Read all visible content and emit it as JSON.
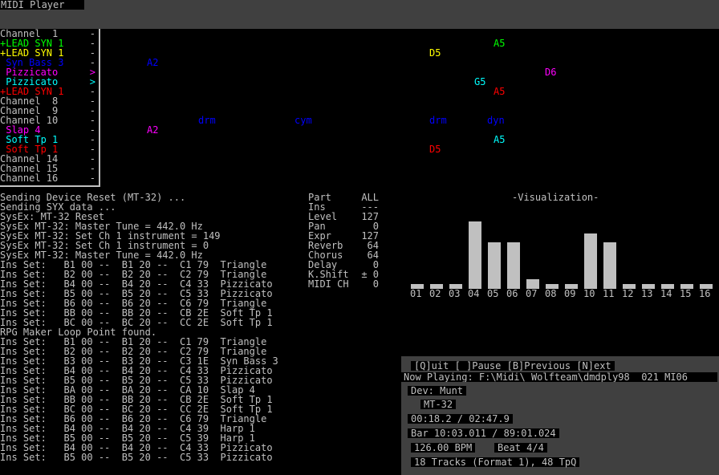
{
  "window": {
    "title": "MIDI Player"
  },
  "colors": {
    "background": "#000000",
    "text": "#c0c0c0",
    "panel": "#404040"
  },
  "channels": [
    {
      "label": "Channel  1",
      "color": "#c0c0c0",
      "marker": "-"
    },
    {
      "label": "+LEAD SYN 1",
      "color": "#00ff00",
      "marker": "-"
    },
    {
      "label": "+LEAD SYN 1",
      "color": "#ffff00",
      "marker": "-"
    },
    {
      "label": " Syn Bass 3",
      "color": "#0000ff",
      "marker": "-"
    },
    {
      "label": " Pizzicato",
      "color": "#ff00ff",
      "marker": ">"
    },
    {
      "label": " Pizzicato",
      "color": "#00ffff",
      "marker": ">"
    },
    {
      "label": "+LEAD SYN 1",
      "color": "#ff0000",
      "marker": "-"
    },
    {
      "label": "Channel  8",
      "color": "#c0c0c0",
      "marker": "-"
    },
    {
      "label": "Channel  9",
      "color": "#c0c0c0",
      "marker": "-"
    },
    {
      "label": "Channel 10",
      "color": "#c0c0c0",
      "marker": "-"
    },
    {
      "label": " Slap 4",
      "color": "#ff00ff",
      "marker": "-"
    },
    {
      "label": " Soft Tp 1",
      "color": "#00ffff",
      "marker": "-"
    },
    {
      "label": " Soft Tp 1",
      "color": "#ff0000",
      "marker": "-"
    },
    {
      "label": "Channel 14",
      "color": "#c0c0c0",
      "marker": "-"
    },
    {
      "label": "Channel 15",
      "color": "#c0c0c0",
      "marker": "-"
    },
    {
      "label": "Channel 16",
      "color": "#c0c0c0",
      "marker": "-"
    }
  ],
  "notes": [
    {
      "text": "A5",
      "row": 1,
      "col": 615,
      "color": "#00ff00"
    },
    {
      "text": "D5",
      "row": 2,
      "col": 535,
      "color": "#ffff00"
    },
    {
      "text": "A2",
      "row": 3,
      "col": 183,
      "color": "#0000ff"
    },
    {
      "text": "D6",
      "row": 4,
      "col": 679,
      "color": "#ff00ff"
    },
    {
      "text": "G5",
      "row": 5,
      "col": 591,
      "color": "#00ffff"
    },
    {
      "text": "A5",
      "row": 6,
      "col": 615,
      "color": "#ff0000"
    },
    {
      "text": "drm",
      "row": 9,
      "col": 247,
      "color": "#0000ff"
    },
    {
      "text": "cym",
      "row": 9,
      "col": 367,
      "color": "#0000ff"
    },
    {
      "text": "drm",
      "row": 9,
      "col": 535,
      "color": "#0000ff"
    },
    {
      "text": "dyn",
      "row": 9,
      "col": 607,
      "color": "#0000ff"
    },
    {
      "text": "A2",
      "row": 10,
      "col": 183,
      "color": "#ff00ff"
    },
    {
      "text": "A5",
      "row": 11,
      "col": 615,
      "color": "#00ffff"
    },
    {
      "text": "D5",
      "row": 12,
      "col": 535,
      "color": "#ff0000"
    }
  ],
  "log": [
    "Sending Device Reset (MT-32) ...",
    "Sending SYX data ...",
    "SysEx: MT-32 Reset",
    "SysEx MT-32: Master Tune = 442.0 Hz",
    "SysEx MT-32: Set Ch 1 instrument = 149",
    "SysEx MT-32: Set Ch 1 instrument = 0",
    "SysEx MT-32: Master Tune = 442.0 Hz",
    "Ins Set:   B1 00 --  B1 20 --  C1 79  Triangle",
    "Ins Set:   B2 00 --  B2 20 --  C2 79  Triangle",
    "Ins Set:   B4 00 --  B4 20 --  C4 33  Pizzicato",
    "Ins Set:   B5 00 --  B5 20 --  C5 33  Pizzicato",
    "Ins Set:   B6 00 --  B6 20 --  C6 79  Triangle",
    "Ins Set:   BB 00 --  BB 20 --  CB 2E  Soft Tp 1",
    "Ins Set:   BC 00 --  BC 20 --  CC 2E  Soft Tp 1",
    "RPG Maker Loop Point found.",
    "Ins Set:   B1 00 --  B1 20 --  C1 79  Triangle",
    "Ins Set:   B2 00 --  B2 20 --  C2 79  Triangle",
    "Ins Set:   B3 00 --  B3 20 --  C3 1E  Syn Bass 3",
    "Ins Set:   B4 00 --  B4 20 --  C4 33  Pizzicato",
    "Ins Set:   B5 00 --  B5 20 --  C5 33  Pizzicato",
    "Ins Set:   BA 00 --  BA 20 --  CA 10  Slap 4",
    "Ins Set:   BB 00 --  BB 20 --  CB 2E  Soft Tp 1",
    "Ins Set:   BC 00 --  BC 20 --  CC 2E  Soft Tp 1",
    "Ins Set:   B6 00 --  B6 20 --  C6 79  Triangle",
    "Ins Set:   B4 00 --  B4 20 --  C4 39  Harp 1",
    "Ins Set:   B5 00 --  B5 20 --  C5 39  Harp 1",
    "Ins Set:   B4 00 --  B4 20 --  C4 33  Pizzicato",
    "Ins Set:   B5 00 --  B5 20 --  C5 33  Pizzicato"
  ],
  "params": [
    {
      "key": "Part",
      "value": "ALL"
    },
    {
      "key": "Ins",
      "value": "---"
    },
    {
      "key": "Level",
      "value": "127"
    },
    {
      "key": "Pan",
      "value": "0"
    },
    {
      "key": "Expr",
      "value": "127"
    },
    {
      "key": "Reverb",
      "value": "64"
    },
    {
      "key": "Chorus",
      "value": "64"
    },
    {
      "key": "Delay",
      "value": "0"
    },
    {
      "key": "K.Shift",
      "value": "± 0"
    },
    {
      "key": "MIDI CH",
      "value": "0"
    }
  ],
  "visualization": {
    "title": "-Visualization-",
    "channels": [
      "01",
      "02",
      "03",
      "04",
      "05",
      "06",
      "07",
      "08",
      "09",
      "10",
      "11",
      "12",
      "13",
      "14",
      "15",
      "16"
    ],
    "levels": [
      0.07,
      0.07,
      0.07,
      1.0,
      0.69,
      0.69,
      0.14,
      0.07,
      0.07,
      0.82,
      0.69,
      0.07,
      0.07,
      0.07,
      0.07,
      0.07
    ]
  },
  "controls": {
    "hotkeys": "[Q]uit [ ]Pause [B]Previous [N]ext",
    "now_playing": "Now Playing: F:\\Midi\\_Wolfteam\\dmdply98__021_MI06",
    "device": "Dev: Munt",
    "device_type": "MT-32",
    "time": "00:18.2 / 02:47.9",
    "bar": "Bar 10:03.011 / 89:01.024",
    "bpm": "126.00 BPM",
    "beat": "Beat 4/4",
    "tracks": "18 Tracks (Format 1), 48 TpQ"
  }
}
